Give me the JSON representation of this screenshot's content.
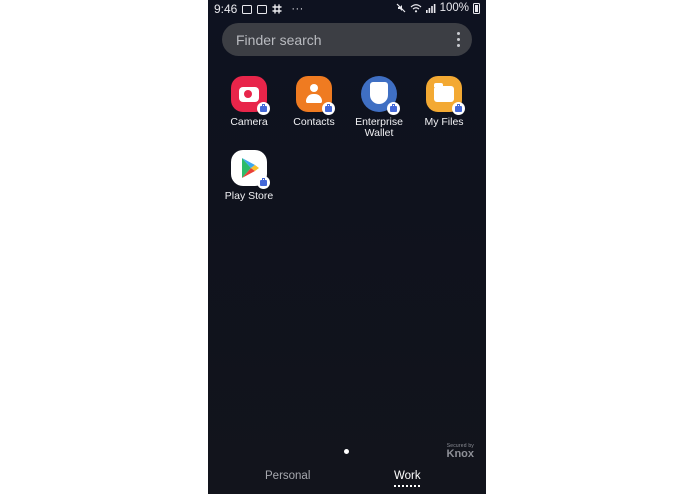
{
  "status_bar": {
    "time": "9:46",
    "more": "···",
    "battery": "100%"
  },
  "search": {
    "placeholder": "Finder search",
    "menu_icon": "more-vert-icon"
  },
  "apps": [
    {
      "label": "Camera",
      "icon": "camera-icon",
      "color": "#e8254a"
    },
    {
      "label": "Contacts",
      "icon": "contacts-icon",
      "color": "#ef7b21"
    },
    {
      "label": "Enterprise Wallet",
      "icon": "shield-icon",
      "color": "#3f6fc3"
    },
    {
      "label": "My Files",
      "icon": "folder-icon",
      "color": "#f3a933"
    },
    {
      "label": "Play Store",
      "icon": "play-store-icon",
      "color": "#ffffff"
    }
  ],
  "badge": {
    "icon": "work-briefcase-icon",
    "color": "#4468d8"
  },
  "knox": {
    "secured_by": "Secured by",
    "brand": "Knox"
  },
  "tabs": {
    "personal": "Personal",
    "work": "Work",
    "active": "Work"
  }
}
